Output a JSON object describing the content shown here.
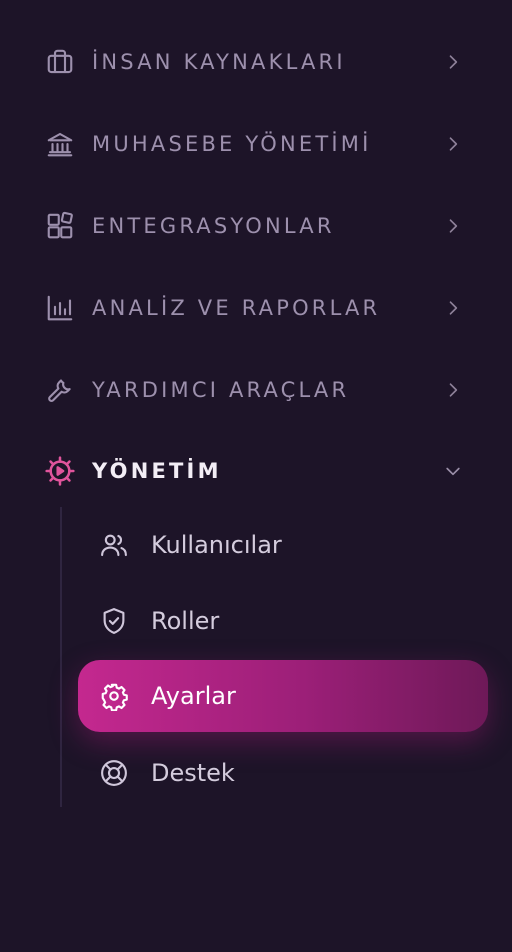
{
  "colors": {
    "background": "#1d1428",
    "muted_text": "#9d90ad",
    "active_accent": "#e0549c",
    "selected_gradient_start": "#c4288f",
    "selected_gradient_end": "#6e1958"
  },
  "menu": [
    {
      "label": "İNSAN KAYNAKLARI",
      "icon": "briefcase-icon",
      "chevron": "chevron-right-icon"
    },
    {
      "label": "MUHASEBE YÖNETİMİ",
      "icon": "bank-icon",
      "chevron": "chevron-right-icon"
    },
    {
      "label": "ENTEGRASYONLAR",
      "icon": "integrations-icon",
      "chevron": "chevron-right-icon"
    },
    {
      "label": "ANALİZ VE RAPORLAR",
      "icon": "bar-chart-icon",
      "chevron": "chevron-right-icon"
    },
    {
      "label": "YARDIMCI ARAÇLAR",
      "icon": "wrench-icon",
      "chevron": "chevron-right-icon"
    },
    {
      "label": "YÖNETİM",
      "icon": "gear-play-icon",
      "chevron": "chevron-down-icon",
      "expanded": true
    }
  ],
  "submenu": [
    {
      "label": "Kullanıcılar",
      "icon": "users-icon"
    },
    {
      "label": "Roller",
      "icon": "shield-check-icon"
    },
    {
      "label": "Ayarlar",
      "icon": "gear-icon",
      "selected": true
    },
    {
      "label": "Destek",
      "icon": "lifebuoy-icon"
    }
  ]
}
